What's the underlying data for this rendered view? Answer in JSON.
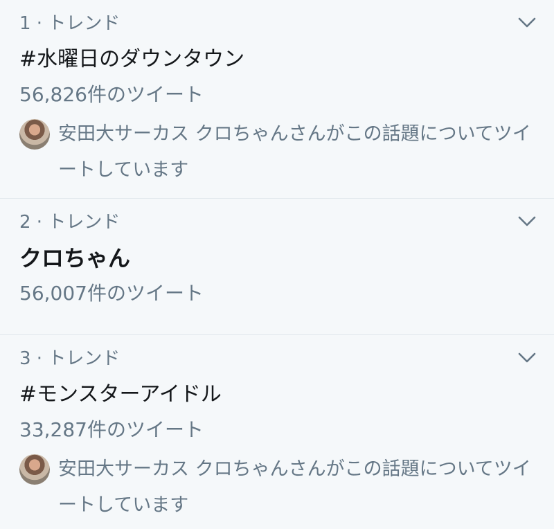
{
  "trends": [
    {
      "meta": "1 · トレンド",
      "title": "#水曜日のダウンタウン",
      "count": "56,826件のツイート",
      "context": "安田大サーカス クロちゃんさんがこの話題についてツイートしています"
    },
    {
      "meta": "2 · トレンド",
      "title": "クロちゃん",
      "count": "56,007件のツイート"
    },
    {
      "meta": "3 · トレンド",
      "title": "#モンスターアイドル",
      "count": "33,287件のツイート",
      "context": "安田大サーカス クロちゃんさんがこの話題についてツイートしています"
    }
  ],
  "icons": {
    "chevron": "chevron-down-icon",
    "avatar": "avatar"
  },
  "colors": {
    "background": "#f5f8fa",
    "secondary_text": "#657786",
    "primary_text": "#14171a",
    "divider": "#e1e8ed"
  }
}
